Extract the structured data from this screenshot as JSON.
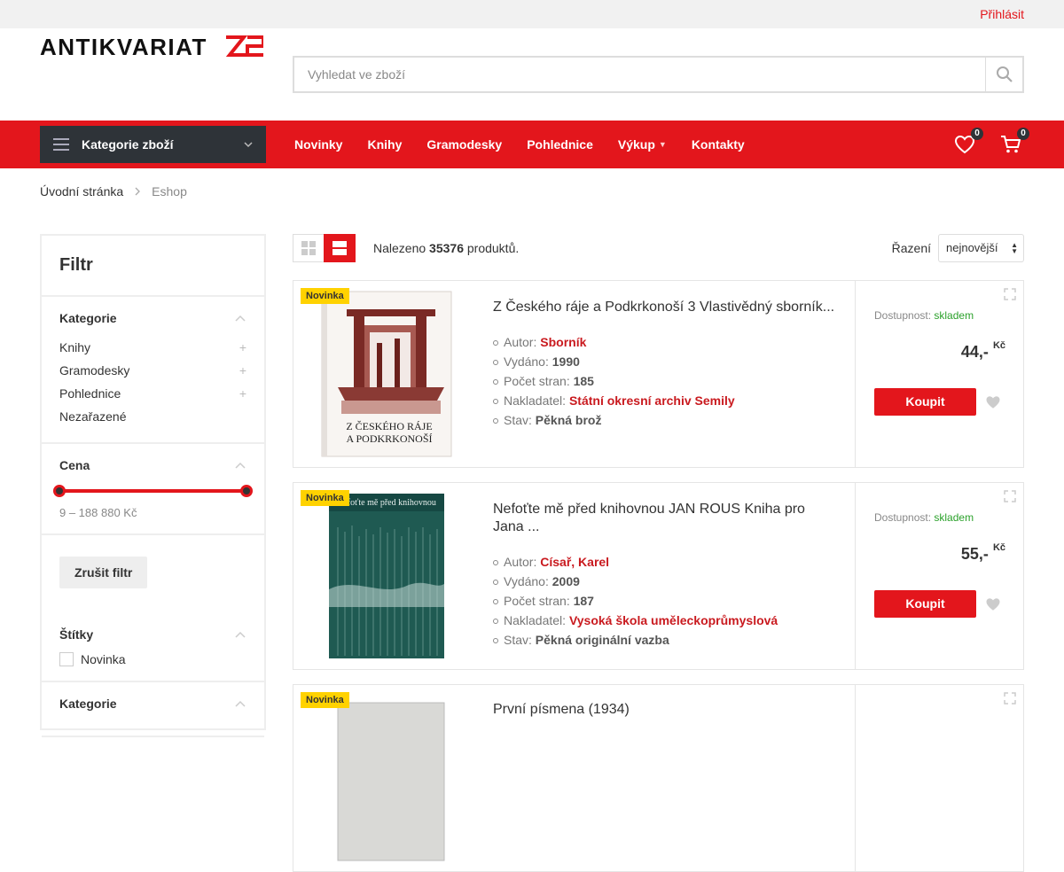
{
  "topbar": {
    "login": "Přihlásit"
  },
  "header": {
    "logo_text": "ANTIKVARIAT22",
    "search_placeholder": "Vyhledat ve zboží"
  },
  "nav": {
    "categories_label": "Kategorie zboží",
    "items": [
      "Novinky",
      "Knihy",
      "Gramodesky",
      "Pohlednice",
      "Výkup",
      "Kontakty"
    ],
    "wishlist_count": "0",
    "cart_count": "0"
  },
  "breadcrumb": [
    "Úvodní stránka",
    "Eshop"
  ],
  "filter": {
    "title": "Filtr",
    "category_title": "Kategorie",
    "categories": [
      "Knihy",
      "Gramodesky",
      "Pohlednice",
      "Nezařazené"
    ],
    "price_title": "Cena",
    "price_range": "9 – 188 880 Kč",
    "clear_label": "Zrušit filtr",
    "tags_title": "Štítky",
    "tag_novinka": "Novinka",
    "category2_title": "Kategorie"
  },
  "toolbar": {
    "found_prefix": "Nalezeno",
    "found_count": "35376",
    "found_suffix": "produktů.",
    "sort_label": "Řazení",
    "sort_value": "nejnovější"
  },
  "labels": {
    "author": "Autor:",
    "published": "Vydáno:",
    "pages": "Počet stran:",
    "publisher": "Nakladatel:",
    "condition": "Stav:",
    "availability": "Dostupnost:",
    "buy": "Koupit",
    "currency": "Kč"
  },
  "products": [
    {
      "tag": "Novinka",
      "title": "Z Českého ráje a Podkrkonoší 3 Vlastivědný sborník...",
      "author": "Sborník",
      "published": "1990",
      "pages": "185",
      "publisher": "Státní okresní archiv Semily",
      "condition": "Pěkná brož",
      "availability": "skladem",
      "price": "44,-",
      "cover_text_1": "Z ČESKÉHO RÁJE",
      "cover_text_2": "A PODKRKONOŠÍ"
    },
    {
      "tag": "Novinka",
      "title": "Nefoťte mě před knihovnou JAN ROUS Kniha pro Jana ...",
      "author": "Císař, Karel",
      "published": "2009",
      "pages": "187",
      "publisher": "Vysoká škola uměleckoprůmyslová",
      "condition": "Pěkná originální vazba",
      "availability": "skladem",
      "price": "55,-",
      "cover_text_1": "Nefoťte mě před knihovnou"
    },
    {
      "tag": "Novinka",
      "title": "První písmena (1934)"
    }
  ]
}
